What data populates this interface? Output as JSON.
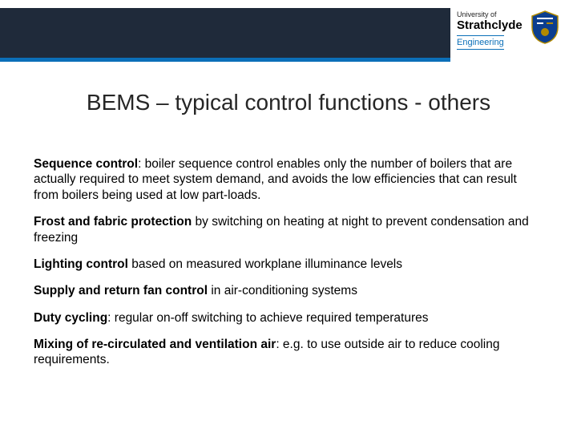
{
  "header": {
    "uni_small": "University of",
    "uni_big": "Strathclyde",
    "eng": "Engineering"
  },
  "title": "BEMS – typical control functions - others",
  "paras": [
    {
      "lead": "Sequence control",
      "rest": ": boiler sequence control enables only the number of boilers that are actually required to meet system demand, and avoids the low efficiencies that can result from boilers being used at low part-loads."
    },
    {
      "lead": "Frost and fabric protection",
      "rest": " by switching on heating at night to prevent condensation and freezing"
    },
    {
      "lead": "Lighting control",
      "rest": " based on measured workplane illuminance levels"
    },
    {
      "lead": "Supply and return fan control",
      "rest": " in air-conditioning systems"
    },
    {
      "lead": "Duty cycling",
      "rest": ": regular on-off switching to achieve required temperatures"
    },
    {
      "lead": "Mixing of re-circulated and ventilation air",
      "rest": ": e.g. to use outside air to reduce cooling requirements."
    }
  ]
}
